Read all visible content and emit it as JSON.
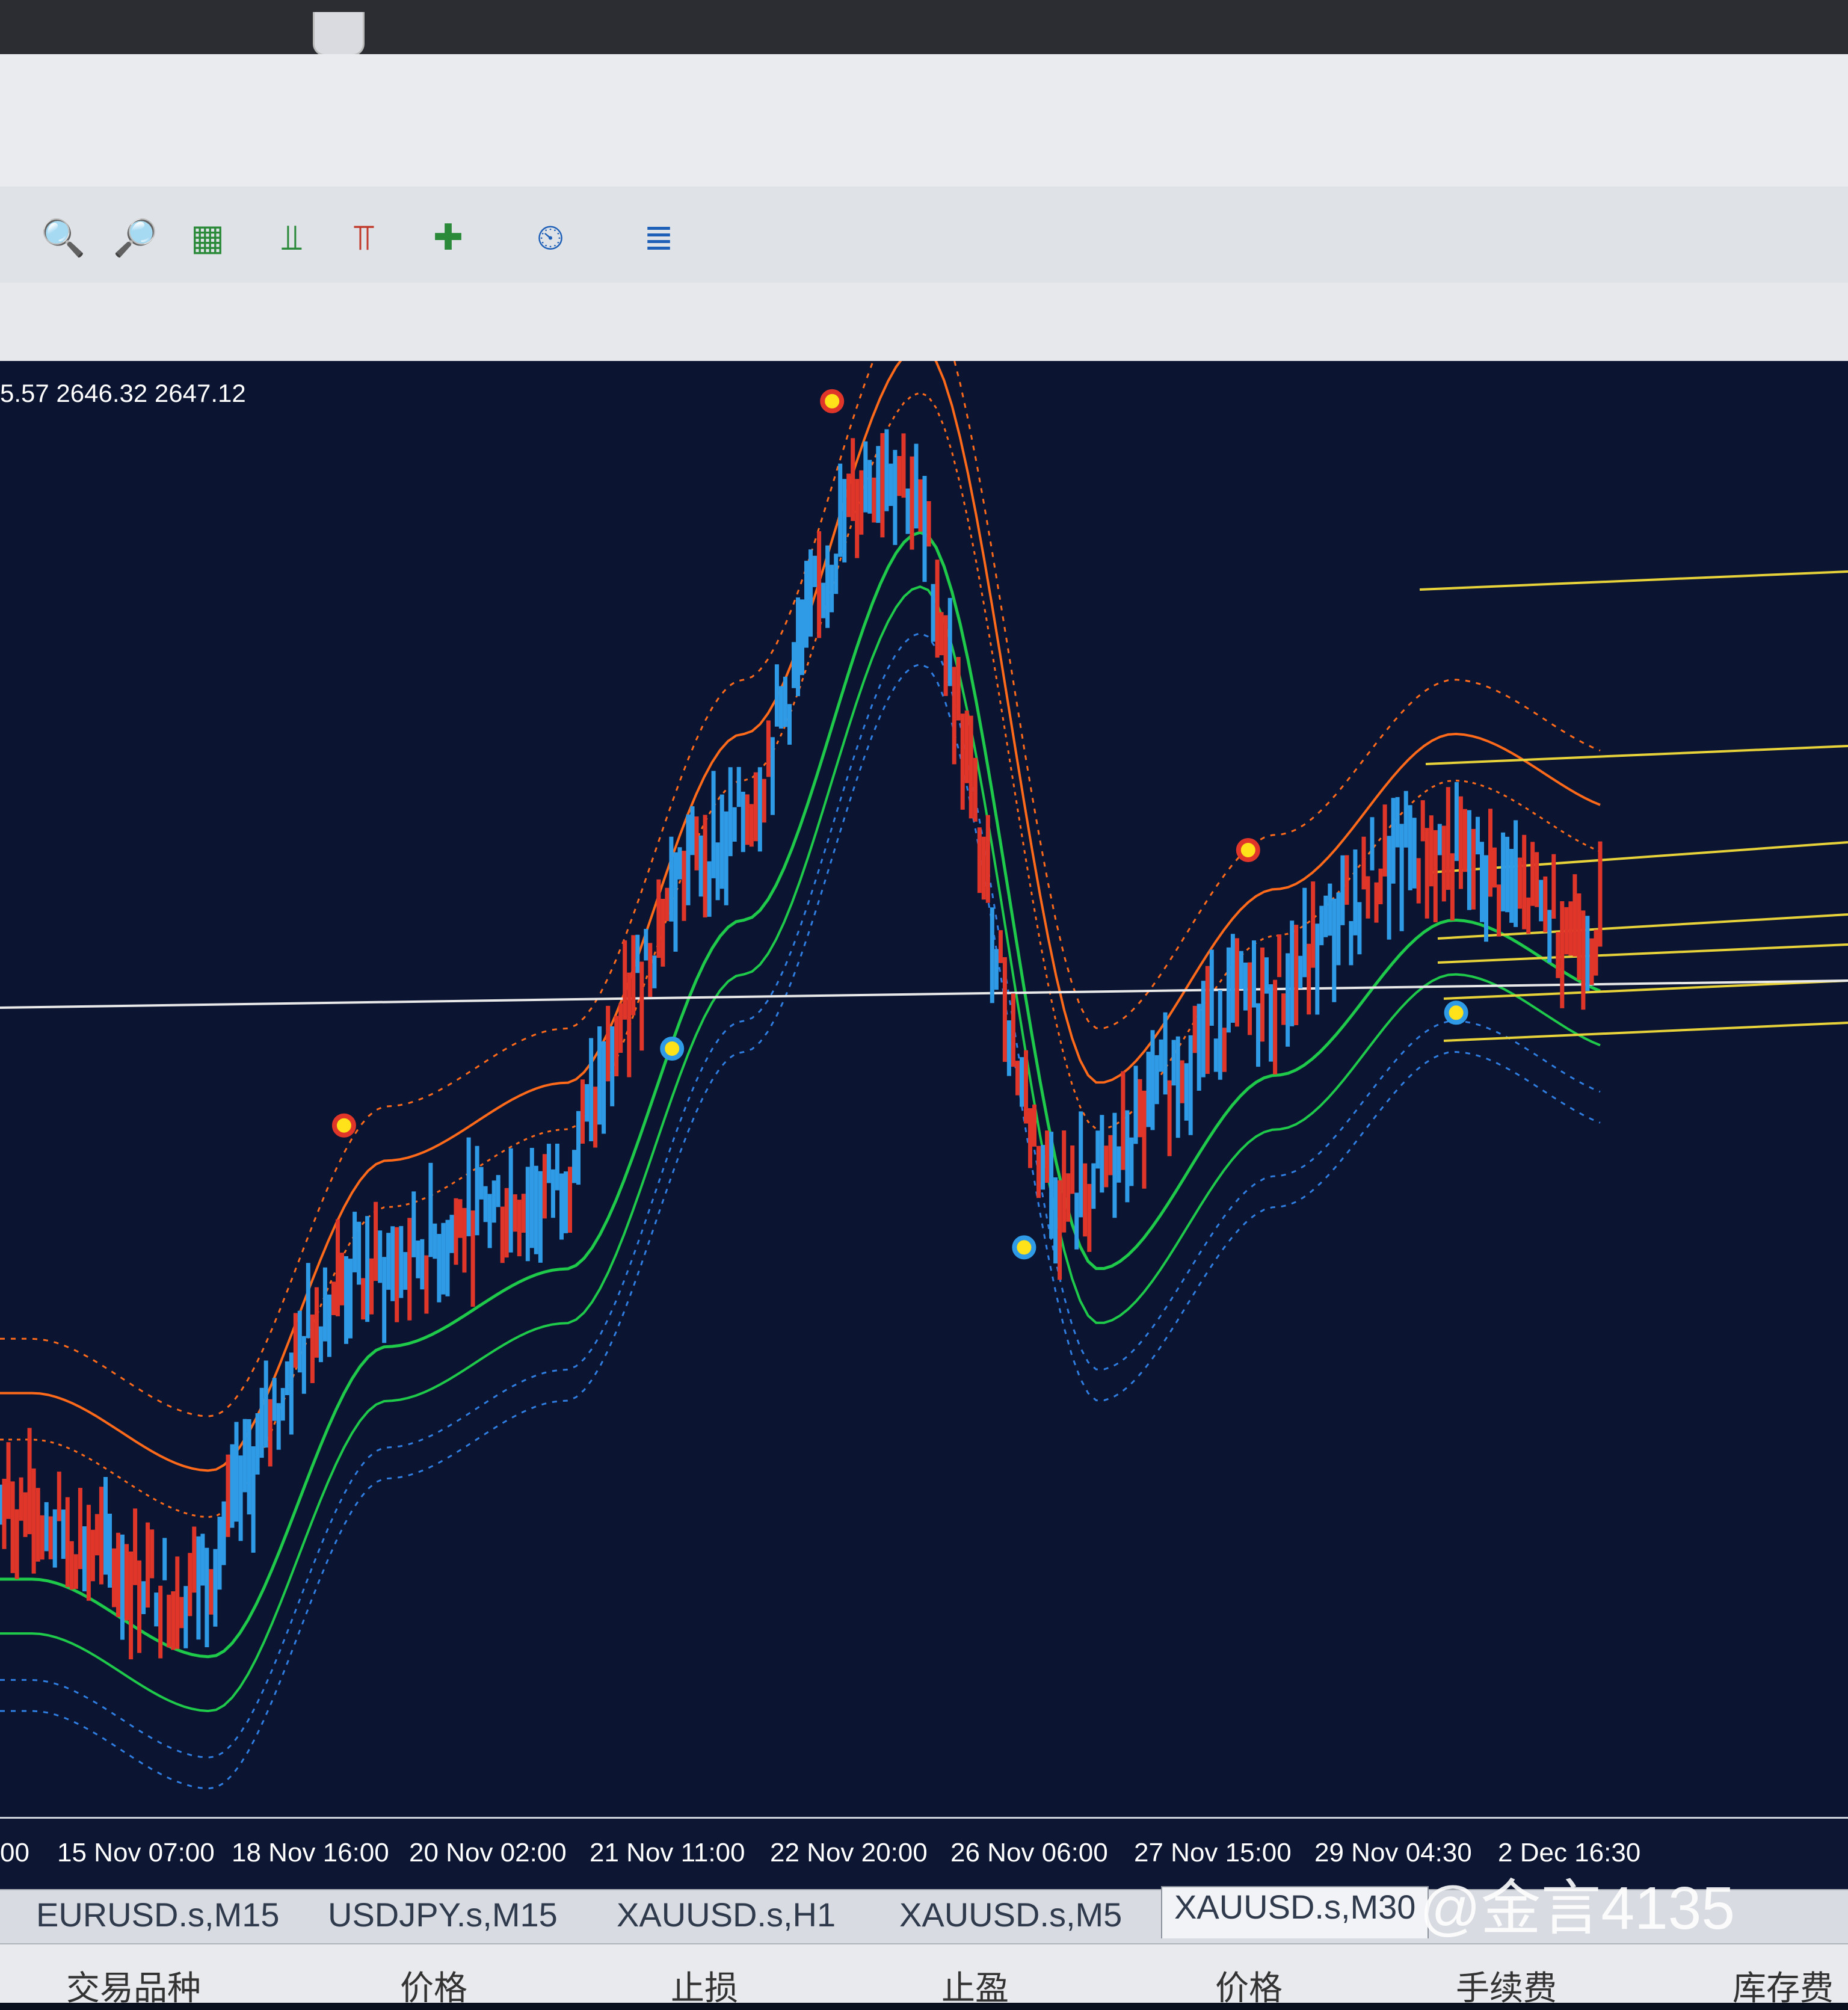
{
  "ohlc_readout": "5.57 2646.32 2647.12",
  "toolbar": {
    "icons": [
      "zoom-in-icon",
      "zoom-out-icon",
      "tile-windows-icon",
      "chart-shift-icon",
      "auto-scroll-icon",
      "add-indicator-icon",
      "clock-icon",
      "templates-icon"
    ]
  },
  "x_axis": {
    "labels": [
      "00",
      "15 Nov 07:00",
      "18 Nov 16:00",
      "20 Nov 02:00",
      "21 Nov 11:00",
      "22 Nov 20:00",
      "26 Nov 06:00",
      "27 Nov 15:00",
      "29 Nov 04:30",
      "2 Dec 16:30"
    ]
  },
  "symbol_tabs": [
    "EURUSD.s,M15",
    "USDJPY.s,M15",
    "XAUUSD.s,H1",
    "XAUUSD.s,M5",
    "XAUUSD.s,M30"
  ],
  "active_tab_index": 4,
  "terminal_columns": [
    "交易品种",
    "价格",
    "止损",
    "止盈",
    "价格",
    "手续费",
    "库存费"
  ],
  "watermark": "@金言4135",
  "colors": {
    "chart_bg": "#0b1532",
    "bull": "#2f9be6",
    "bear": "#e0362a",
    "upper_band": "#ff6a1a",
    "lower_band": "#1fc94a",
    "lower_dash": "#2f7de0",
    "level_line": "#e8d23a"
  },
  "chart_data": {
    "type": "line",
    "x": [
      "00",
      "15 Nov 07:00",
      "18 Nov 16:00",
      "20 Nov 02:00",
      "21 Nov 11:00",
      "22 Nov 20:00",
      "26 Nov 06:00",
      "27 Nov 15:00",
      "29 Nov 04:30",
      "2 Dec 16:30"
    ],
    "series": [
      {
        "values": [
          2575,
          2565,
          2605,
          2615,
          2660,
          2710,
          2615,
          2640,
          2660,
          2650
        ]
      }
    ]
  }
}
